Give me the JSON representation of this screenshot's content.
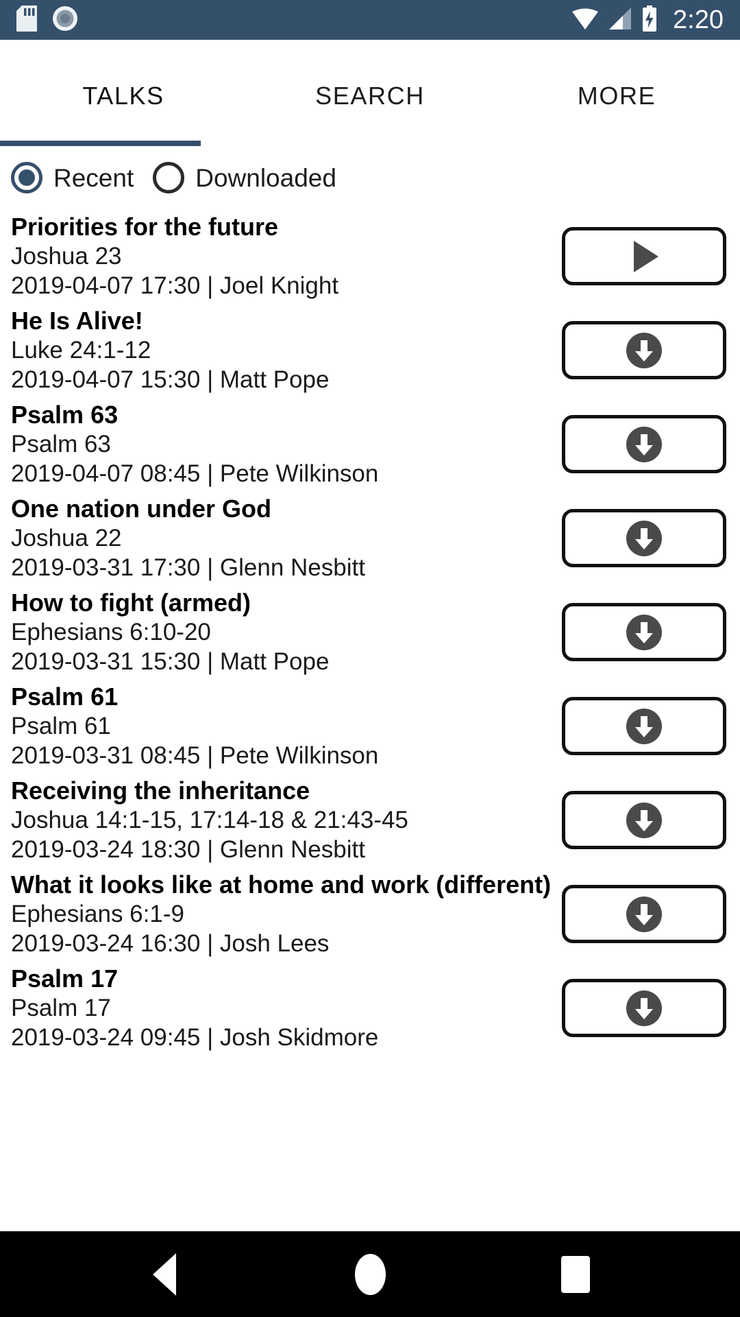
{
  "status_bar": {
    "background": "#35506b",
    "time": "2:20",
    "icons_left": [
      "sd-card-icon",
      "recording-circle-icon"
    ],
    "icons_right": [
      "wifi-icon",
      "cellular-signal-icon",
      "battery-charging-icon"
    ]
  },
  "tabs": [
    {
      "label": "TALKS",
      "active": true
    },
    {
      "label": "SEARCH",
      "active": false
    },
    {
      "label": "MORE",
      "active": false
    }
  ],
  "filter": {
    "options": [
      {
        "label": "Recent",
        "selected": true
      },
      {
        "label": "Downloaded",
        "selected": false
      }
    ],
    "accent": "#35506b"
  },
  "talks": [
    {
      "title": "Priorities for the future",
      "reference": "Joshua 23",
      "meta": "2019-04-07 17:30 | Joel Knight",
      "action": "play",
      "action_icon": "play-icon"
    },
    {
      "title": "He Is Alive!",
      "reference": "Luke 24:1-12",
      "meta": "2019-04-07 15:30 | Matt Pope",
      "action": "download",
      "action_icon": "download-icon"
    },
    {
      "title": "Psalm 63",
      "reference": "Psalm 63",
      "meta": "2019-04-07 08:45 | Pete Wilkinson",
      "action": "download",
      "action_icon": "download-icon"
    },
    {
      "title": "One nation under God",
      "reference": "Joshua 22",
      "meta": "2019-03-31 17:30 | Glenn Nesbitt",
      "action": "download",
      "action_icon": "download-icon"
    },
    {
      "title": "How to fight (armed)",
      "reference": "Ephesians 6:10-20",
      "meta": "2019-03-31 15:30 | Matt Pope",
      "action": "download",
      "action_icon": "download-icon"
    },
    {
      "title": "Psalm 61",
      "reference": "Psalm 61",
      "meta": "2019-03-31 08:45 | Pete Wilkinson",
      "action": "download",
      "action_icon": "download-icon"
    },
    {
      "title": "Receiving the inheritance",
      "reference": "Joshua 14:1-15, 17:14-18 & 21:43-45",
      "meta": "2019-03-24 18:30 | Glenn Nesbitt",
      "action": "download",
      "action_icon": "download-icon"
    },
    {
      "title": "What it looks like at home and work (different)",
      "reference": "Ephesians 6:1-9",
      "meta": "2019-03-24 16:30 | Josh Lees",
      "action": "download",
      "action_icon": "download-icon"
    },
    {
      "title": "Psalm 17",
      "reference": "Psalm 17",
      "meta": "2019-03-24 09:45 | Josh Skidmore",
      "action": "download",
      "action_icon": "download-icon"
    }
  ],
  "nav_bar": {
    "background": "#000000",
    "buttons": [
      {
        "name": "back-button",
        "icon": "triangle-left-icon"
      },
      {
        "name": "home-button",
        "icon": "circle-icon"
      },
      {
        "name": "recents-button",
        "icon": "square-icon"
      }
    ]
  }
}
